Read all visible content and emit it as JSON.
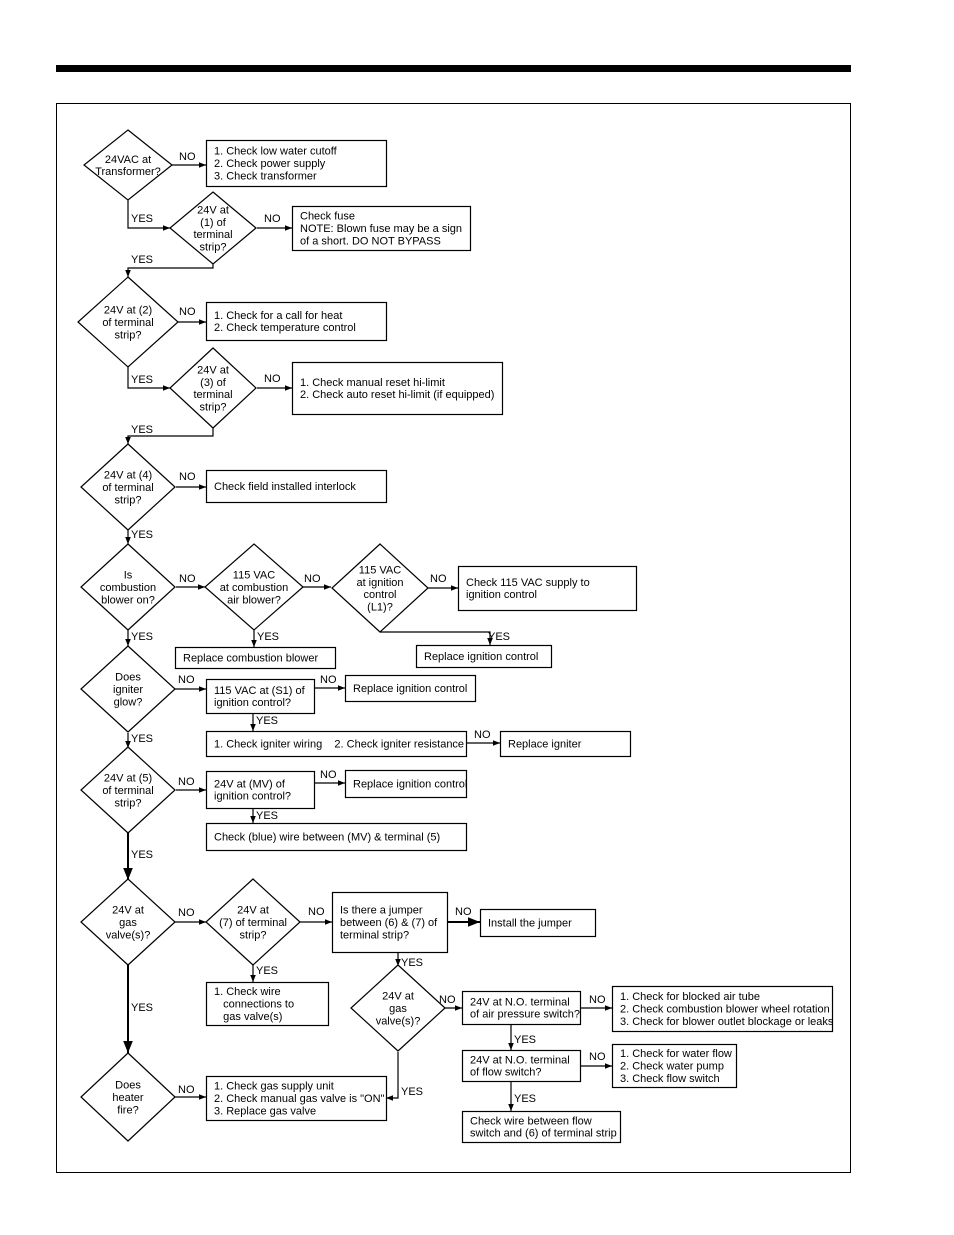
{
  "nodes": {
    "d1": {
      "shape": "decision",
      "lines": [
        "24VAC at",
        "Transformer?"
      ]
    },
    "b1": {
      "shape": "action",
      "lines": [
        "1. Check low water cutoff",
        "2. Check power supply",
        "3. Check transformer"
      ]
    },
    "d2": {
      "shape": "decision",
      "lines": [
        "24V at",
        "(1) of",
        "terminal",
        "strip?"
      ]
    },
    "b2": {
      "shape": "action",
      "lines": [
        "Check fuse",
        "NOTE: Blown fuse may be a sign",
        "of a short. DO NOT BYPASS"
      ]
    },
    "d3": {
      "shape": "decision",
      "lines": [
        "24V at (2)",
        "of terminal",
        "strip?"
      ]
    },
    "b3": {
      "shape": "action",
      "lines": [
        "1. Check for a call for heat",
        "2. Check temperature control"
      ]
    },
    "d4": {
      "shape": "decision",
      "lines": [
        "24V at",
        "(3) of",
        "terminal",
        "strip?"
      ]
    },
    "b4": {
      "shape": "action",
      "lines": [
        "1. Check manual reset hi-limit",
        "2. Check auto reset hi-limit (if equipped)"
      ]
    },
    "d5": {
      "shape": "decision",
      "lines": [
        "24V at (4)",
        "of terminal",
        "strip?"
      ]
    },
    "b5": {
      "shape": "action",
      "lines": [
        "Check field installed interlock"
      ]
    },
    "d6": {
      "shape": "decision",
      "lines": [
        "Is",
        "combustion",
        "blower on?"
      ]
    },
    "d7": {
      "shape": "decision",
      "lines": [
        "115 VAC",
        "at combustion",
        "air blower?"
      ]
    },
    "d8": {
      "shape": "decision",
      "lines": [
        "115 VAC",
        "at ignition",
        "control",
        "(L1)?"
      ]
    },
    "b6": {
      "shape": "action",
      "lines": [
        "Check 115 VAC supply to",
        "ignition control"
      ]
    },
    "b7": {
      "shape": "action",
      "lines": [
        "Replace combustion blower"
      ]
    },
    "b8": {
      "shape": "action",
      "lines": [
        "Replace ignition control"
      ]
    },
    "d9": {
      "shape": "decision",
      "lines": [
        "Does",
        "igniter",
        "glow?"
      ]
    },
    "b9": {
      "shape": "action",
      "lines": [
        "115 VAC at (S1) of",
        "ignition control?"
      ]
    },
    "b10": {
      "shape": "action",
      "lines": [
        "Replace ignition control"
      ]
    },
    "b11": {
      "shape": "action",
      "lines": [
        "1. Check igniter wiring    2. Check igniter resistance"
      ]
    },
    "b12": {
      "shape": "action",
      "lines": [
        "Replace igniter"
      ]
    },
    "d10": {
      "shape": "decision",
      "lines": [
        "24V at (5)",
        "of terminal",
        "strip?"
      ]
    },
    "b13": {
      "shape": "action",
      "lines": [
        "24V at (MV) of",
        "ignition control?"
      ]
    },
    "b14": {
      "shape": "action",
      "lines": [
        "Replace ignition control"
      ]
    },
    "b15": {
      "shape": "action",
      "lines": [
        "Check (blue) wire between (MV) & terminal (5)"
      ]
    },
    "d11": {
      "shape": "decision",
      "lines": [
        "24V at",
        "gas",
        "valve(s)?"
      ]
    },
    "d12": {
      "shape": "decision",
      "lines": [
        "24V at",
        "(7) of terminal",
        "strip?"
      ]
    },
    "b16": {
      "shape": "action",
      "lines": [
        "Is there a jumper",
        "between (6) & (7) of",
        "terminal strip?"
      ]
    },
    "b17": {
      "shape": "action",
      "lines": [
        "Install the jumper"
      ]
    },
    "b18": {
      "shape": "action",
      "lines": [
        "1. Check wire",
        "   connections to",
        "   gas valve(s)"
      ]
    },
    "d13": {
      "shape": "decision",
      "lines": [
        "24V at",
        "gas",
        "valve(s)?"
      ]
    },
    "b19": {
      "shape": "action",
      "lines": [
        "24V at N.O. terminal",
        "of air pressure switch?"
      ]
    },
    "b20": {
      "shape": "action",
      "lines": [
        "1. Check for blocked air tube",
        "2. Check combustion blower wheel rotation",
        "3. Check for blower outlet blockage or leaks"
      ]
    },
    "b21": {
      "shape": "action",
      "lines": [
        "24V at N.O. terminal",
        "of flow switch?"
      ]
    },
    "b22": {
      "shape": "action",
      "lines": [
        "1. Check for water flow",
        "2. Check water pump",
        "3. Check flow switch"
      ]
    },
    "b23": {
      "shape": "action",
      "lines": [
        "Check wire between flow",
        "switch and (6) of terminal strip"
      ]
    },
    "d14": {
      "shape": "decision",
      "lines": [
        "Does",
        "heater",
        "fire?"
      ]
    },
    "b24": {
      "shape": "action",
      "lines": [
        "1. Check gas supply unit",
        "2. Check manual gas valve is \"ON\"",
        "3. Replace gas valve"
      ]
    }
  },
  "edges": [
    {
      "from": "d1",
      "to": "b1",
      "label": "NO"
    },
    {
      "from": "d1",
      "to": "d2",
      "label": "YES"
    },
    {
      "from": "d2",
      "to": "b2",
      "label": "NO"
    },
    {
      "from": "d2",
      "to": "d3",
      "label": "YES"
    },
    {
      "from": "d3",
      "to": "b3",
      "label": "NO"
    },
    {
      "from": "d3",
      "to": "d4",
      "label": "YES"
    },
    {
      "from": "d4",
      "to": "b4",
      "label": "NO"
    },
    {
      "from": "d4",
      "to": "d5",
      "label": "YES"
    },
    {
      "from": "d5",
      "to": "b5",
      "label": "NO"
    },
    {
      "from": "d5",
      "to": "d6",
      "label": "YES"
    },
    {
      "from": "d6",
      "to": "d7",
      "label": "NO"
    },
    {
      "from": "d7",
      "to": "d8",
      "label": "NO"
    },
    {
      "from": "d8",
      "to": "b6",
      "label": "NO"
    },
    {
      "from": "d8",
      "to": "b8",
      "label": "YES"
    },
    {
      "from": "d7",
      "to": "b7",
      "label": "YES"
    },
    {
      "from": "d6",
      "to": "d9",
      "label": "YES"
    },
    {
      "from": "d9",
      "to": "b9",
      "label": "NO"
    },
    {
      "from": "b9",
      "to": "b10",
      "label": "NO"
    },
    {
      "from": "b9",
      "to": "b11",
      "label": "YES"
    },
    {
      "from": "b11",
      "to": "b12",
      "label": "NO"
    },
    {
      "from": "d9",
      "to": "d10",
      "label": "YES"
    },
    {
      "from": "d10",
      "to": "b13",
      "label": "NO"
    },
    {
      "from": "b13",
      "to": "b14",
      "label": "NO"
    },
    {
      "from": "b13",
      "to": "b15",
      "label": "YES"
    },
    {
      "from": "d10",
      "to": "d11",
      "label": "YES"
    },
    {
      "from": "d11",
      "to": "d12",
      "label": "NO"
    },
    {
      "from": "d12",
      "to": "b16",
      "label": "NO"
    },
    {
      "from": "b16",
      "to": "b17",
      "label": "NO"
    },
    {
      "from": "d12",
      "to": "b18",
      "label": "YES"
    },
    {
      "from": "b16",
      "to": "d13",
      "label": "YES"
    },
    {
      "from": "d13",
      "to": "b19",
      "label": "NO"
    },
    {
      "from": "b19",
      "to": "b20",
      "label": "NO"
    },
    {
      "from": "b19",
      "to": "b21",
      "label": "YES"
    },
    {
      "from": "b21",
      "to": "b22",
      "label": "NO"
    },
    {
      "from": "b21",
      "to": "b23",
      "label": "YES"
    },
    {
      "from": "d13",
      "to": "b24",
      "label": "YES"
    },
    {
      "from": "d11",
      "to": "d14",
      "label": "YES"
    },
    {
      "from": "d14",
      "to": "b24",
      "label": "NO"
    }
  ]
}
